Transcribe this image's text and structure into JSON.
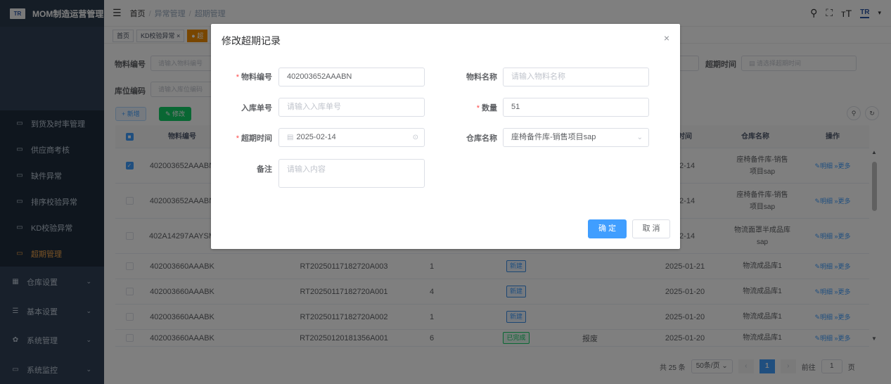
{
  "app": {
    "logo": "TR",
    "title": "MOM制造运营管理"
  },
  "breadcrumb": [
    "首页",
    "异常管理",
    "超期管理"
  ],
  "tags": [
    "首页",
    "KD校验异常",
    "超"
  ],
  "sidebar": {
    "items": [
      {
        "label": "到货及时率管理"
      },
      {
        "label": "供应商考核"
      },
      {
        "label": "缺件异常"
      },
      {
        "label": "排序校验异常"
      },
      {
        "label": "KD校验异常"
      },
      {
        "label": "超期管理"
      },
      {
        "label": "仓库设置"
      },
      {
        "label": "基本设置"
      },
      {
        "label": "系统管理"
      },
      {
        "label": "系统监控"
      }
    ]
  },
  "filters": {
    "material_code_label": "物料编号",
    "material_code_placeholder": "请输入物料编号",
    "location_code_label": "库位编码",
    "location_code_placeholder": "请输入库位编码",
    "overdue_time_label": "超期时间",
    "overdue_time_placeholder": "请选择超期时间"
  },
  "toolbar": {
    "add": "+ 新增",
    "edit": "修改"
  },
  "table": {
    "headers": {
      "code": "物料编号",
      "time": "时间",
      "warehouse": "仓库名称",
      "ops": "操作"
    },
    "rows": [
      {
        "checked": true,
        "code": "402003652AAABN",
        "order": "",
        "qty": "",
        "status": "",
        "extra": "",
        "date": "02-14",
        "warehouse": "座椅备件库-销售项目sap"
      },
      {
        "checked": false,
        "code": "402003652AAABN",
        "order": "",
        "qty": "",
        "status": "",
        "extra": "",
        "date": "02-14",
        "warehouse": "座椅备件库-销售项目sap"
      },
      {
        "checked": false,
        "code": "402A14297AAYSM",
        "order": "",
        "qty": "",
        "status": "",
        "extra": "",
        "date": "02-14",
        "warehouse": "物流面罩半成品库sap"
      },
      {
        "checked": false,
        "code": "402003660AAABK",
        "order": "RT20250117182720A003",
        "qty": "1",
        "status": "新建",
        "extra": "",
        "date": "2025-01-21",
        "warehouse": "物流成品库1"
      },
      {
        "checked": false,
        "code": "402003660AAABK",
        "order": "RT20250117182720A001",
        "qty": "4",
        "status": "新建",
        "extra": "",
        "date": "2025-01-20",
        "warehouse": "物流成品库1"
      },
      {
        "checked": false,
        "code": "402003660AAABK",
        "order": "RT20250117182720A002",
        "qty": "1",
        "status": "新建",
        "extra": "",
        "date": "2025-01-20",
        "warehouse": "物流成品库1"
      },
      {
        "checked": false,
        "code": "402003660AAABK",
        "order": "RT20250120181356A001",
        "qty": "6",
        "status": "已完成",
        "extra": "报废",
        "date": "2025-01-20",
        "warehouse": "物流成品库1"
      }
    ],
    "op_detail": "明细",
    "op_more": "更多"
  },
  "pagination": {
    "total": "共 25 条",
    "page_size": "50条/页",
    "current": "1",
    "goto_label": "前往",
    "goto_value": "1",
    "page_unit": "页"
  },
  "dialog": {
    "title": "修改超期记录",
    "fields": {
      "material_code_label": "物料编号",
      "material_code_value": "402003652AAABN",
      "material_name_label": "物料名称",
      "material_name_placeholder": "请输入物料名称",
      "inbound_no_label": "入库单号",
      "inbound_no_placeholder": "请输入入库单号",
      "qty_label": "数量",
      "qty_value": "51",
      "overdue_time_label": "超期时间",
      "overdue_time_value": "2025-02-14",
      "warehouse_label": "仓库名称",
      "warehouse_value": "座椅备件库-销售项目sap",
      "remark_label": "备注",
      "remark_placeholder": "请输入内容"
    },
    "ok": "确 定",
    "cancel": "取 消"
  },
  "colors": {
    "primary": "#409eff",
    "sidebar": "#304156",
    "active": "#f4a74b",
    "success": "#13ce66"
  }
}
